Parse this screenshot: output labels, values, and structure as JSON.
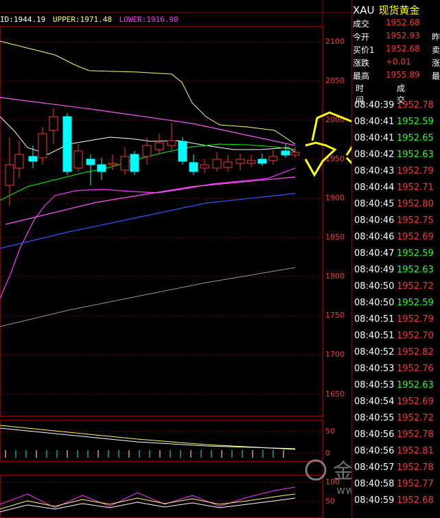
{
  "info": {
    "mid": "ID:1944.19",
    "upper": "UPPER:1971.48",
    "lower": "LOWER:1916.90"
  },
  "axis": {
    "main": [
      "2100",
      "2050",
      "2000",
      "1950",
      "1900",
      "1850",
      "1800",
      "1750",
      "1700",
      "1650"
    ],
    "sub1": [
      "50",
      "0"
    ],
    "sub2": [
      "100",
      "50"
    ]
  },
  "watermark": {
    "brand": "金采网",
    "url": "www.jrwei.com"
  },
  "quote": {
    "symbol": "XAU",
    "name": "现货黄金",
    "rows": [
      {
        "label": "成交",
        "value": "1952.68",
        "sub": ""
      },
      {
        "label": "今开",
        "value": "1952.93",
        "sub": "昨"
      },
      {
        "label": "买价1",
        "value": "1952.68",
        "sub": "卖"
      },
      {
        "label": "涨跌",
        "value": "+0.01",
        "sub": "涨"
      },
      {
        "label": "最高",
        "value": "1955.89",
        "sub": "最"
      }
    ]
  },
  "trades_header": {
    "time": "时间",
    "price": "成交"
  },
  "trades": [
    {
      "time": "08:40:39",
      "price": "1952.78",
      "dir": "up"
    },
    {
      "time": "08:40:41",
      "price": "1952.59",
      "dir": "down"
    },
    {
      "time": "08:40:41",
      "price": "1952.65",
      "dir": "down"
    },
    {
      "time": "08:40:42",
      "price": "1952.63",
      "dir": "down"
    },
    {
      "time": "08:40:43",
      "price": "1952.79",
      "dir": "up"
    },
    {
      "time": "08:40:44",
      "price": "1952.71",
      "dir": "up"
    },
    {
      "time": "08:40:45",
      "price": "1952.80",
      "dir": "up"
    },
    {
      "time": "08:40:46",
      "price": "1952.75",
      "dir": "up"
    },
    {
      "time": "08:40:46",
      "price": "1952.69",
      "dir": "up"
    },
    {
      "time": "08:40:47",
      "price": "1952.59",
      "dir": "down"
    },
    {
      "time": "08:40:49",
      "price": "1952.63",
      "dir": "down"
    },
    {
      "time": "08:40:50",
      "price": "1952.72",
      "dir": "up"
    },
    {
      "time": "08:40:50",
      "price": "1952.59",
      "dir": "down"
    },
    {
      "time": "08:40:51",
      "price": "1952.79",
      "dir": "up"
    },
    {
      "time": "08:40:51",
      "price": "1952.70",
      "dir": "up"
    },
    {
      "time": "08:40:52",
      "price": "1952.82",
      "dir": "up"
    },
    {
      "time": "08:40:53",
      "price": "1952.76",
      "dir": "up"
    },
    {
      "time": "08:40:53",
      "price": "1952.63",
      "dir": "down"
    },
    {
      "time": "08:40:54",
      "price": "1952.69",
      "dir": "up"
    },
    {
      "time": "08:40:55",
      "price": "1952.72",
      "dir": "up"
    },
    {
      "time": "08:40:56",
      "price": "1952.78",
      "dir": "up"
    },
    {
      "time": "08:40:56",
      "price": "1952.81",
      "dir": "up"
    },
    {
      "time": "08:40:57",
      "price": "1952.78",
      "dir": "up"
    },
    {
      "time": "08:40:58",
      "price": "1952.77",
      "dir": "up"
    },
    {
      "time": "08:40:59",
      "price": "1952.68",
      "dir": "up"
    }
  ],
  "colors": {
    "up": "#ff3333",
    "down": "#22ff22",
    "bull_candle": "#ff3333",
    "bear_candle": "#00ffff",
    "upper_band": "#ffff66",
    "mid_band": "#ffffff",
    "lower_band": "#ff33ff",
    "ma_green": "#00ff00",
    "ma_blue": "#3355ff",
    "ma_gray": "#999999",
    "arrows": "#ffff00"
  }
}
